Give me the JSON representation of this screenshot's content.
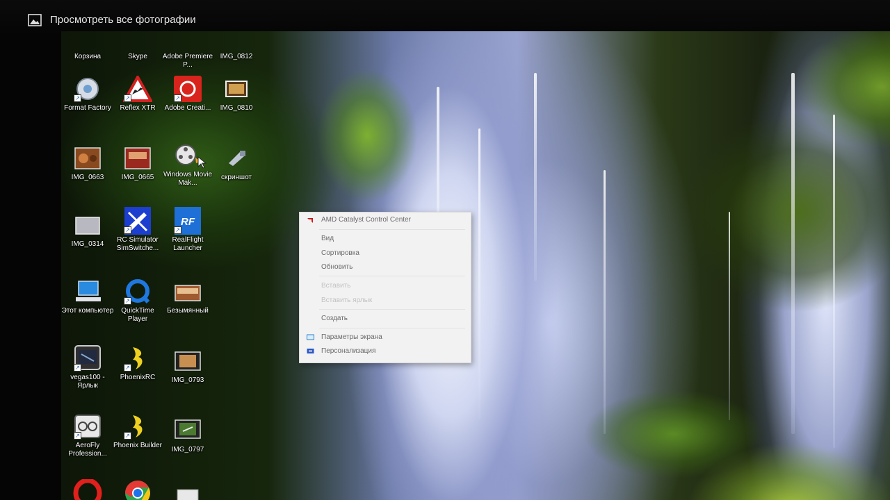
{
  "window": {
    "title": "Просмотреть все фотографии"
  },
  "desktop_icons": [
    {
      "label": "Корзина",
      "icon": "recycle-bin-icon"
    },
    {
      "label": "Skype",
      "icon": "skype-icon"
    },
    {
      "label": "Adobe Premiere P...",
      "icon": "premiere-icon"
    },
    {
      "label": "IMG_0812",
      "icon": "image-file-icon"
    },
    {
      "label": "Format Factory",
      "icon": "format-factory-icon"
    },
    {
      "label": "Reflex XTR",
      "icon": "reflex-xtr-icon"
    },
    {
      "label": "Adobe Creati...",
      "icon": "creative-cloud-icon"
    },
    {
      "label": "IMG_0810",
      "icon": "image-file-icon"
    },
    {
      "label": "IMG_0663",
      "icon": "image-file-icon"
    },
    {
      "label": "IMG_0665",
      "icon": "image-file-icon"
    },
    {
      "label": "Windows Movie Mak...",
      "icon": "movie-maker-icon"
    },
    {
      "label": "скриншот",
      "icon": "screenshot-file-icon"
    },
    {
      "label": "IMG_0314",
      "icon": "image-file-icon"
    },
    {
      "label": "RC Simulator SimSwitche...",
      "icon": "rc-simulator-icon"
    },
    {
      "label": "RealFlight Launcher",
      "icon": "realflight-icon"
    },
    {
      "label": "Этот компьютер",
      "icon": "computer-icon"
    },
    {
      "label": "QuickTime Player",
      "icon": "quicktime-icon"
    },
    {
      "label": "Безымянный",
      "icon": "image-file-icon"
    },
    {
      "label": "vegas100 - Ярлык",
      "icon": "vegas-icon"
    },
    {
      "label": "PhoenixRC",
      "icon": "phoenix-icon"
    },
    {
      "label": "IMG_0793",
      "icon": "video-file-icon"
    },
    {
      "label": "AeroFly Profession...",
      "icon": "aerofly-icon"
    },
    {
      "label": "Phoenix Builder",
      "icon": "phoenix-icon"
    },
    {
      "label": "IMG_0797",
      "icon": "video-file-icon"
    },
    {
      "label": "",
      "icon": "opera-icon"
    },
    {
      "label": "",
      "icon": "chrome-icon"
    },
    {
      "label": "",
      "icon": "document-file-icon"
    }
  ],
  "context_menu": {
    "items": [
      {
        "label": "AMD Catalyst Control Center",
        "icon": "amd-icon",
        "enabled": true
      },
      {
        "label": "Вид",
        "enabled": true
      },
      {
        "label": "Сортировка",
        "enabled": true
      },
      {
        "label": "Обновить",
        "enabled": true
      },
      {
        "label": "Вставить",
        "enabled": false
      },
      {
        "label": "Вставить ярлык",
        "enabled": false
      },
      {
        "label": "Создать",
        "enabled": true
      },
      {
        "label": "Параметры экрана",
        "icon": "display-settings-icon",
        "enabled": true
      },
      {
        "label": "Персонализация",
        "icon": "personalization-icon",
        "enabled": true
      }
    ]
  },
  "colors": {
    "title_bar": "#050505",
    "menu_background": "#f2f2f2",
    "menu_text": "#6a6a6a",
    "menu_disabled_text": "#c3c3c3"
  }
}
